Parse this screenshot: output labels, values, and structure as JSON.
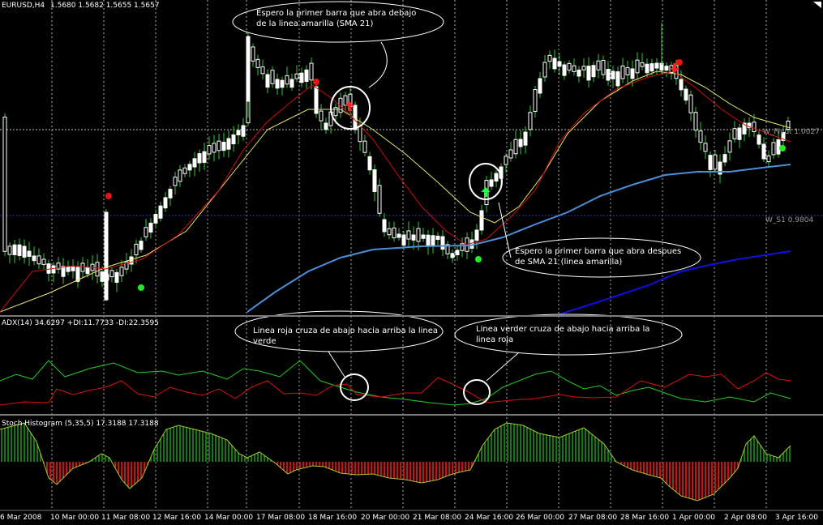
{
  "main_panel": {
    "symbol": "EURUSD,H4",
    "ohlc": "1.5680 1.5682 1.5655 1.5657",
    "price_tag_top": "1.0027",
    "price_tag_s1": "W_S1 0.9804",
    "price_tag_pivot": "W_Pivot"
  },
  "adx_panel": {
    "label": "ADX(14) 34.6297 +DI:11.7733 -DI:22.3595"
  },
  "stoch_panel": {
    "label": "Stoch Histogram (5,35,5) 17.3188 17.3188"
  },
  "callouts": {
    "c1": "Espero la primer barra que abra debajo de la linea amarilla (SMA 21)",
    "c2": "Espero la primer barra que abra despues de SMA 21 (linea amarilla)",
    "c3": "Linea roja cruza de abajo hacia arriba la linea verde",
    "c4": "Linea verder cruza de abajo hacia arriba la linea roja"
  },
  "time_axis": [
    "6 Mar 2008",
    "10 Mar 00:00",
    "11 Mar 08:00",
    "12 Mar 16:00",
    "14 Mar 00:00",
    "17 Mar 08:00",
    "18 Mar 16:00",
    "20 Mar 00:00",
    "21 Mar 08:00",
    "24 Mar 16:00",
    "26 Mar 00:00",
    "27 Mar 08:00",
    "28 Mar 16:00",
    "1 Apr 00:00",
    "2 Apr 08:00",
    "3 Apr 16:00"
  ],
  "colors": {
    "background": "#000000",
    "candle": "#ffffff",
    "candle_fill_up": "#000000",
    "candle_fill_down": "#ffffff",
    "wick": "#33cc33",
    "sma21_yellow": "#e8e870",
    "ema_red": "#d01010",
    "slow_ma_blue": "#4a8fd8",
    "pivot_blue": "#1010e0",
    "plus_di_green": "#22cc22",
    "minus_di_red": "#dd1111",
    "hist_green": "#117a11",
    "hist_red": "#cc1111",
    "hist_line": "#aacc33",
    "grid": "#b0b0b0",
    "separator": "#7a7a7a",
    "dot_green": "#22ee22",
    "dot_red": "#ee1111"
  }
}
